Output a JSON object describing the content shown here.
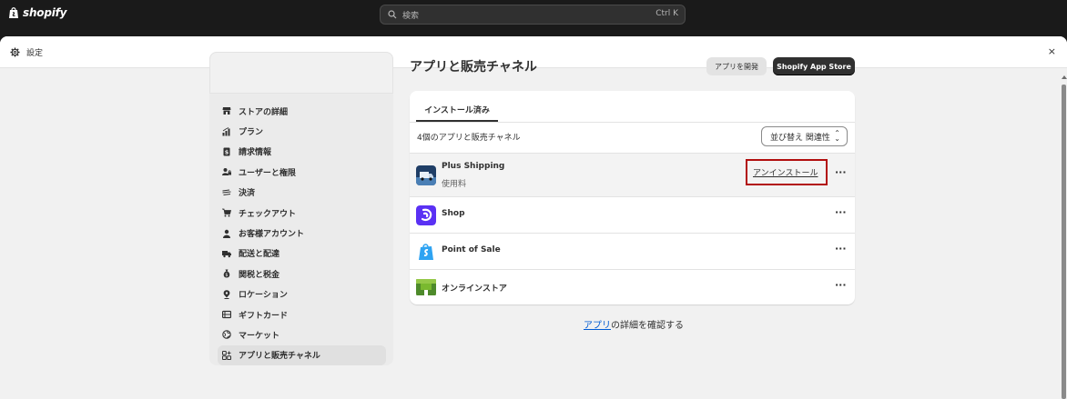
{
  "topbar": {
    "logo_text": "shopify",
    "search_placeholder": "検索",
    "search_shortcut": "Ctrl K"
  },
  "modal": {
    "title": "設定",
    "close": "×"
  },
  "sidebar": {
    "items": [
      {
        "label": "ストアの詳細",
        "icon": "store-icon"
      },
      {
        "label": "プラン",
        "icon": "plan-icon"
      },
      {
        "label": "請求情報",
        "icon": "billing-icon"
      },
      {
        "label": "ユーザーと権限",
        "icon": "users-icon"
      },
      {
        "label": "決済",
        "icon": "payments-icon"
      },
      {
        "label": "チェックアウト",
        "icon": "cart-icon"
      },
      {
        "label": "お客様アカウント",
        "icon": "person-icon"
      },
      {
        "label": "配送と配達",
        "icon": "truck-icon"
      },
      {
        "label": "関税と税金",
        "icon": "tax-icon"
      },
      {
        "label": "ロケーション",
        "icon": "location-icon"
      },
      {
        "label": "ギフトカード",
        "icon": "gift-card-icon"
      },
      {
        "label": "マーケット",
        "icon": "globe-icon"
      },
      {
        "label": "アプリと販売チャネル",
        "icon": "apps-icon",
        "active": true
      }
    ]
  },
  "main": {
    "title": "アプリと販売チャネル",
    "dev_button": "アプリを開発",
    "store_button": "Shopify App Store",
    "tab": "インストール済み",
    "count_text": "4個のアプリと販売チャネル",
    "sort_label": "並び替え 関連性",
    "apps": [
      {
        "name": "Plus Shipping",
        "sub": "使用料",
        "action": "アンインストール",
        "more": "···",
        "icon": "plus-shipping-icon"
      },
      {
        "name": "Shop",
        "more": "···",
        "icon": "shop-icon"
      },
      {
        "name": "Point of Sale",
        "more": "···",
        "icon": "pos-icon"
      },
      {
        "name": "オンラインストア",
        "more": "···",
        "icon": "online-store-icon"
      }
    ],
    "footer_link": "アプリ",
    "footer_rest": "の詳細を確認する"
  },
  "colors": {
    "topbar": "#1a1a1a",
    "page_bg": "#f1f1f1",
    "highlight_box": "#b20e0e",
    "link": "#005bd3"
  }
}
